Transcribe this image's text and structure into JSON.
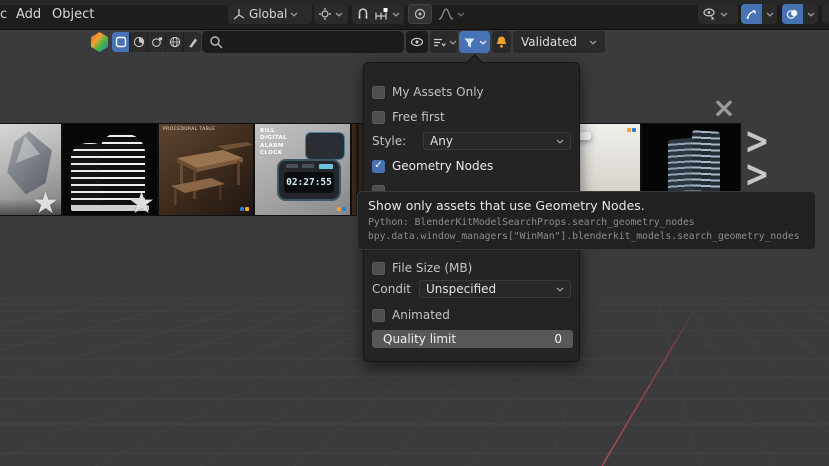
{
  "topbar": {
    "clipped_menu": "c",
    "add_label": "Add",
    "object_label": "Object",
    "orientation_value": "Global"
  },
  "bk_header": {
    "search_value": "",
    "filter_ribbon_value": "Validated"
  },
  "filter_popup": {
    "my_assets_label": "My Assets Only",
    "free_first_label": "Free first",
    "style_label": "Style:",
    "style_value": "Any",
    "geometry_nodes_label": "Geometry Nodes",
    "file_size_label": "File Size (MB)",
    "condition_label": "Conditi...",
    "condition_value": "Unspecified",
    "animated_label": "Animated",
    "quality_label": "Quality limit",
    "quality_value": "0"
  },
  "tooltip": {
    "title": "Show only assets that use Geometry Nodes.",
    "python_line1": "Python: BlenderKitModelSearchProps.search_geometry_nodes",
    "python_line2": "bpy.data.window_managers[\"WinMan\"].blenderkit_models.search_geometry_nodes"
  },
  "assets": {
    "thumbnails": [
      {
        "name": "rock-crystal"
      },
      {
        "name": "curved-building"
      },
      {
        "name": "procedural-table",
        "caption": "PROCEDURAL TABLE"
      },
      {
        "name": "digital-alarm-clock",
        "caption": "BILL DIGITAL ALARM CLOCK",
        "display": "02:27:55"
      },
      {
        "name": "bookshelf-partial"
      },
      {
        "name": "interior-room"
      },
      {
        "name": "glass-skyscraper"
      }
    ]
  },
  "glyphs": {
    "close": "×",
    "next": ">",
    "star": "★",
    "check": "✓"
  },
  "colors": {
    "accent_blue": "#4772b3",
    "bell_orange": "#f0a32a",
    "axis_red": "#c05252",
    "viewport_bg": "#3b3b3d"
  }
}
